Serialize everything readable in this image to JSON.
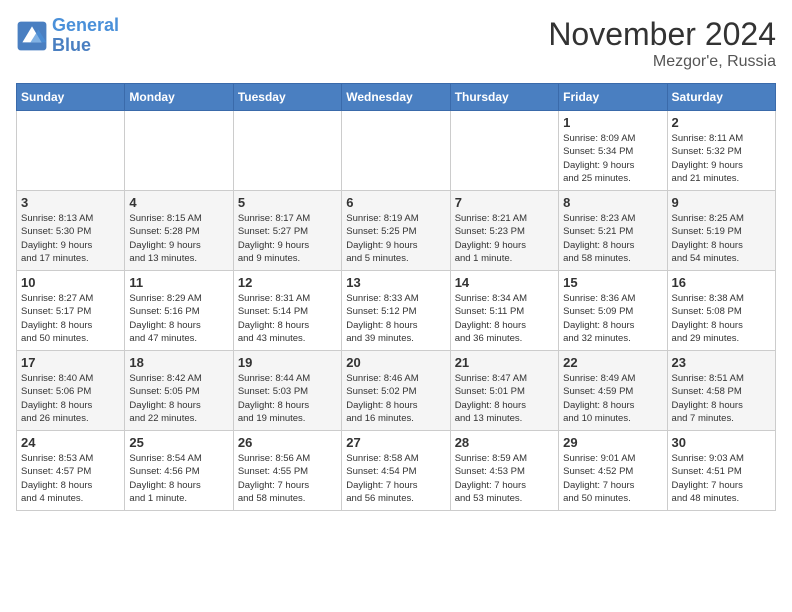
{
  "header": {
    "logo_line1": "General",
    "logo_line2": "Blue",
    "month": "November 2024",
    "location": "Mezgor'e, Russia"
  },
  "days_of_week": [
    "Sunday",
    "Monday",
    "Tuesday",
    "Wednesday",
    "Thursday",
    "Friday",
    "Saturday"
  ],
  "weeks": [
    [
      {
        "day": "",
        "info": ""
      },
      {
        "day": "",
        "info": ""
      },
      {
        "day": "",
        "info": ""
      },
      {
        "day": "",
        "info": ""
      },
      {
        "day": "",
        "info": ""
      },
      {
        "day": "1",
        "info": "Sunrise: 8:09 AM\nSunset: 5:34 PM\nDaylight: 9 hours\nand 25 minutes."
      },
      {
        "day": "2",
        "info": "Sunrise: 8:11 AM\nSunset: 5:32 PM\nDaylight: 9 hours\nand 21 minutes."
      }
    ],
    [
      {
        "day": "3",
        "info": "Sunrise: 8:13 AM\nSunset: 5:30 PM\nDaylight: 9 hours\nand 17 minutes."
      },
      {
        "day": "4",
        "info": "Sunrise: 8:15 AM\nSunset: 5:28 PM\nDaylight: 9 hours\nand 13 minutes."
      },
      {
        "day": "5",
        "info": "Sunrise: 8:17 AM\nSunset: 5:27 PM\nDaylight: 9 hours\nand 9 minutes."
      },
      {
        "day": "6",
        "info": "Sunrise: 8:19 AM\nSunset: 5:25 PM\nDaylight: 9 hours\nand 5 minutes."
      },
      {
        "day": "7",
        "info": "Sunrise: 8:21 AM\nSunset: 5:23 PM\nDaylight: 9 hours\nand 1 minute."
      },
      {
        "day": "8",
        "info": "Sunrise: 8:23 AM\nSunset: 5:21 PM\nDaylight: 8 hours\nand 58 minutes."
      },
      {
        "day": "9",
        "info": "Sunrise: 8:25 AM\nSunset: 5:19 PM\nDaylight: 8 hours\nand 54 minutes."
      }
    ],
    [
      {
        "day": "10",
        "info": "Sunrise: 8:27 AM\nSunset: 5:17 PM\nDaylight: 8 hours\nand 50 minutes."
      },
      {
        "day": "11",
        "info": "Sunrise: 8:29 AM\nSunset: 5:16 PM\nDaylight: 8 hours\nand 47 minutes."
      },
      {
        "day": "12",
        "info": "Sunrise: 8:31 AM\nSunset: 5:14 PM\nDaylight: 8 hours\nand 43 minutes."
      },
      {
        "day": "13",
        "info": "Sunrise: 8:33 AM\nSunset: 5:12 PM\nDaylight: 8 hours\nand 39 minutes."
      },
      {
        "day": "14",
        "info": "Sunrise: 8:34 AM\nSunset: 5:11 PM\nDaylight: 8 hours\nand 36 minutes."
      },
      {
        "day": "15",
        "info": "Sunrise: 8:36 AM\nSunset: 5:09 PM\nDaylight: 8 hours\nand 32 minutes."
      },
      {
        "day": "16",
        "info": "Sunrise: 8:38 AM\nSunset: 5:08 PM\nDaylight: 8 hours\nand 29 minutes."
      }
    ],
    [
      {
        "day": "17",
        "info": "Sunrise: 8:40 AM\nSunset: 5:06 PM\nDaylight: 8 hours\nand 26 minutes."
      },
      {
        "day": "18",
        "info": "Sunrise: 8:42 AM\nSunset: 5:05 PM\nDaylight: 8 hours\nand 22 minutes."
      },
      {
        "day": "19",
        "info": "Sunrise: 8:44 AM\nSunset: 5:03 PM\nDaylight: 8 hours\nand 19 minutes."
      },
      {
        "day": "20",
        "info": "Sunrise: 8:46 AM\nSunset: 5:02 PM\nDaylight: 8 hours\nand 16 minutes."
      },
      {
        "day": "21",
        "info": "Sunrise: 8:47 AM\nSunset: 5:01 PM\nDaylight: 8 hours\nand 13 minutes."
      },
      {
        "day": "22",
        "info": "Sunrise: 8:49 AM\nSunset: 4:59 PM\nDaylight: 8 hours\nand 10 minutes."
      },
      {
        "day": "23",
        "info": "Sunrise: 8:51 AM\nSunset: 4:58 PM\nDaylight: 8 hours\nand 7 minutes."
      }
    ],
    [
      {
        "day": "24",
        "info": "Sunrise: 8:53 AM\nSunset: 4:57 PM\nDaylight: 8 hours\nand 4 minutes."
      },
      {
        "day": "25",
        "info": "Sunrise: 8:54 AM\nSunset: 4:56 PM\nDaylight: 8 hours\nand 1 minute."
      },
      {
        "day": "26",
        "info": "Sunrise: 8:56 AM\nSunset: 4:55 PM\nDaylight: 7 hours\nand 58 minutes."
      },
      {
        "day": "27",
        "info": "Sunrise: 8:58 AM\nSunset: 4:54 PM\nDaylight: 7 hours\nand 56 minutes."
      },
      {
        "day": "28",
        "info": "Sunrise: 8:59 AM\nSunset: 4:53 PM\nDaylight: 7 hours\nand 53 minutes."
      },
      {
        "day": "29",
        "info": "Sunrise: 9:01 AM\nSunset: 4:52 PM\nDaylight: 7 hours\nand 50 minutes."
      },
      {
        "day": "30",
        "info": "Sunrise: 9:03 AM\nSunset: 4:51 PM\nDaylight: 7 hours\nand 48 minutes."
      }
    ]
  ]
}
